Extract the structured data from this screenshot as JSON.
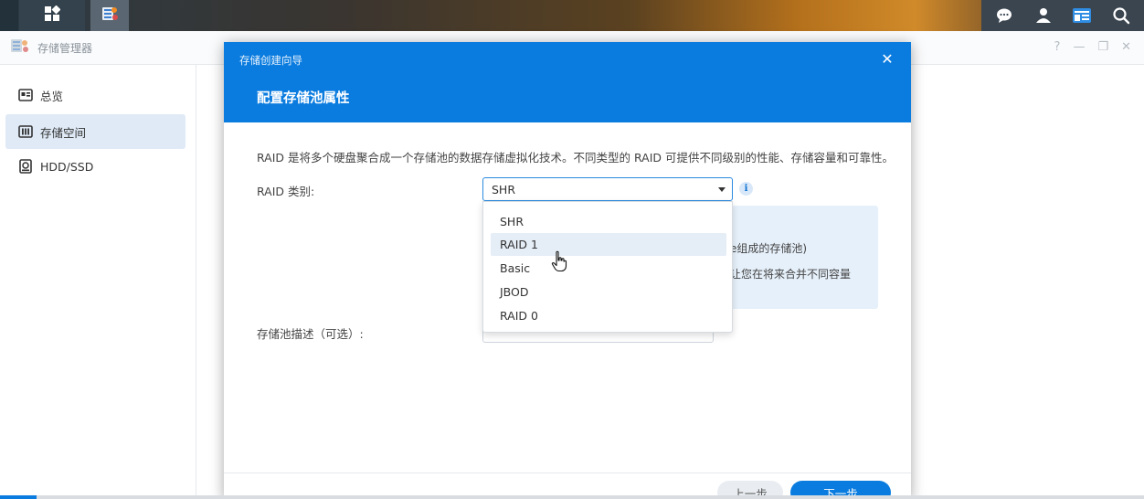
{
  "app": {
    "title": "存储管理器",
    "window_controls": [
      "?",
      "—",
      "❐",
      "✕"
    ]
  },
  "sidebar": {
    "items": [
      {
        "label": "总览",
        "icon": "overview-icon",
        "active": false
      },
      {
        "label": "存储空间",
        "icon": "storage-icon",
        "active": true
      },
      {
        "label": "HDD/SSD",
        "icon": "disk-icon",
        "active": false
      }
    ]
  },
  "wizard": {
    "window_title": "存储创建向导",
    "step_title": "配置存储池属性",
    "close": "✕",
    "description": "RAID 是将多个硬盘聚合成一个存储池的数据存储虚拟化技术。不同类型的 RAID 可提供不同级别的性能、存储容量和可靠性。",
    "raid_label": "RAID 类别:",
    "raid_selected": "SHR",
    "info": "i",
    "raid_options": [
      "SHR",
      "RAID 1",
      "Basic",
      "JBOD",
      "RAID 0"
    ],
    "info_box_line1": "e组成的存储池)",
    "info_box_line2": "让您在将来合并不同容量",
    "pool_desc_label": "存储池描述（可选）:",
    "prev_button": "上一步",
    "next_button": "下一步"
  },
  "colors": {
    "accent": "#0a7cdf",
    "hover_option": "#e5edf6",
    "sidebar_active": "#dfeaf6"
  }
}
